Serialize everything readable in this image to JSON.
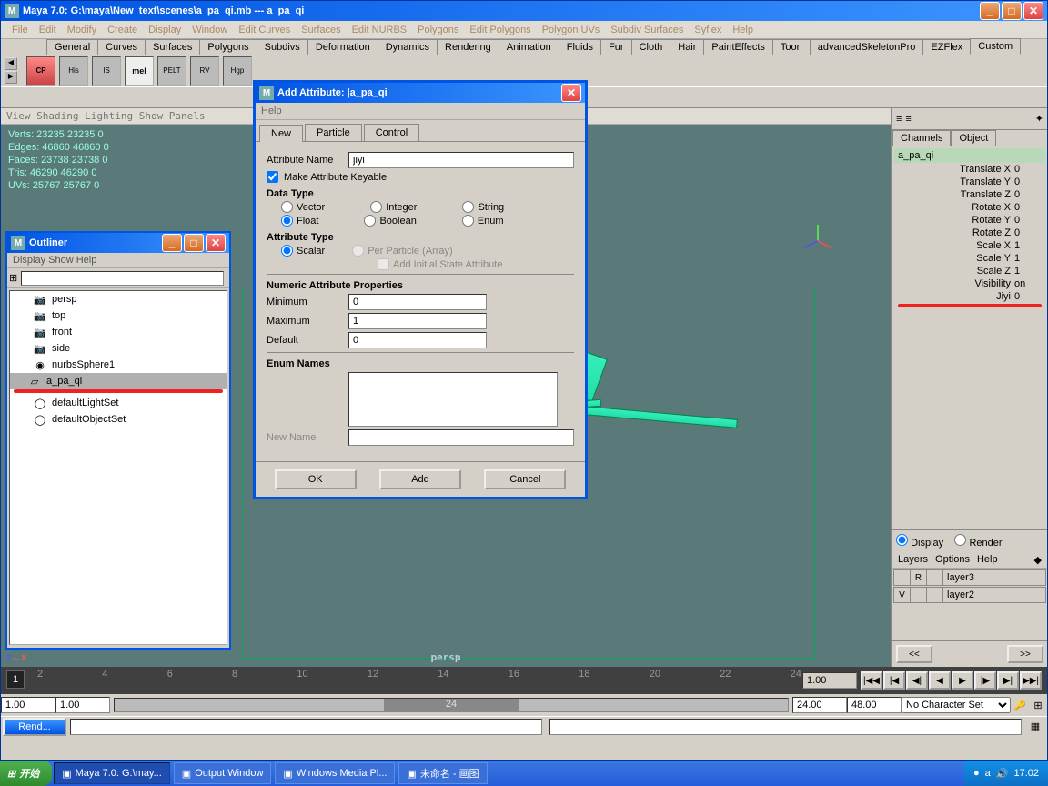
{
  "main": {
    "title": "Maya 7.0: G:\\maya\\New_text\\scenes\\a_pa_qi.mb  ---  a_pa_qi",
    "menus": [
      "File",
      "Edit",
      "Modify",
      "Create",
      "Display",
      "Window",
      "Edit Curves",
      "Surfaces",
      "Edit NURBS",
      "Polygons",
      "Edit Polygons",
      "Polygon UVs",
      "Subdiv Surfaces",
      "Syflex",
      "Help"
    ],
    "shelf_tabs": [
      "General",
      "Curves",
      "Surfaces",
      "Polygons",
      "Subdivs",
      "Deformation",
      "Dynamics",
      "Rendering",
      "Animation",
      "Fluids",
      "Fur",
      "Cloth",
      "Hair",
      "PaintEffects",
      "Toon",
      "advancedSkeletonPro",
      "EZFlex",
      "Custom"
    ],
    "shelf_icons": [
      "CP",
      "His",
      "IS",
      "mel",
      "PELT",
      "RV",
      "Hgp"
    ]
  },
  "viewport": {
    "menu": "View Shading Lighting Show Panels",
    "stats": {
      "verts": "Verts:  23235  23235  0",
      "edges": "Edges:  46860  46860  0",
      "faces": "Faces:  23738  23738  0",
      "tris": "Tris:   46290  46290  0",
      "uvs": "UVs:    25767  25767  0"
    },
    "label": "persp",
    "axis": "z←x"
  },
  "outliner": {
    "title": "Outliner",
    "menus": [
      "Display",
      "Show",
      "Help"
    ],
    "items": [
      {
        "icon": "cam",
        "name": "persp"
      },
      {
        "icon": "cam",
        "name": "top"
      },
      {
        "icon": "cam",
        "name": "front"
      },
      {
        "icon": "cam",
        "name": "side"
      },
      {
        "icon": "nurbs",
        "name": "nurbsSphere1"
      },
      {
        "icon": "mesh",
        "name": "a_pa_qi",
        "selected": true,
        "expand": true
      },
      {
        "icon": "set",
        "name": "defaultLightSet"
      },
      {
        "icon": "set",
        "name": "defaultObjectSet"
      }
    ]
  },
  "dialog": {
    "title": "Add Attribute: |a_pa_qi",
    "help": "Help",
    "tabs": [
      "New",
      "Particle",
      "Control"
    ],
    "attr_name_label": "Attribute Name",
    "attr_name": "jiyi",
    "keyable_label": "Make Attribute Keyable",
    "datatype_label": "Data Type",
    "datatypes": {
      "vector": "Vector",
      "integer": "Integer",
      "string": "String",
      "float": "Float",
      "boolean": "Boolean",
      "enum": "Enum"
    },
    "attrtype_label": "Attribute Type",
    "attrtypes": {
      "scalar": "Scalar",
      "perparticle": "Per Particle (Array)",
      "addinitial": "Add Initial State Attribute"
    },
    "numprops_label": "Numeric Attribute Properties",
    "min_label": "Minimum",
    "min": "0",
    "max_label": "Maximum",
    "max": "1",
    "def_label": "Default",
    "def": "0",
    "enum_label": "Enum Names",
    "newname_label": "New Name",
    "ok": "OK",
    "add": "Add",
    "cancel": "Cancel"
  },
  "channels": {
    "tabs": [
      "Channels",
      "Object"
    ],
    "object": "a_pa_qi",
    "rows": [
      {
        "label": "Translate X",
        "val": "0"
      },
      {
        "label": "Translate Y",
        "val": "0"
      },
      {
        "label": "Translate Z",
        "val": "0"
      },
      {
        "label": "Rotate X",
        "val": "0"
      },
      {
        "label": "Rotate Y",
        "val": "0"
      },
      {
        "label": "Rotate Z",
        "val": "0"
      },
      {
        "label": "Scale X",
        "val": "1"
      },
      {
        "label": "Scale Y",
        "val": "1"
      },
      {
        "label": "Scale Z",
        "val": "1"
      },
      {
        "label": "Visibility",
        "val": "on"
      },
      {
        "label": "Jiyi",
        "val": "0"
      }
    ]
  },
  "layers": {
    "display": "Display",
    "render": "Render",
    "menus": [
      "Layers",
      "Options",
      "Help"
    ],
    "rows": [
      {
        "vis": "",
        "ref": "R",
        "name": "layer3"
      },
      {
        "vis": "V",
        "ref": "",
        "name": "layer2"
      }
    ]
  },
  "time": {
    "ticks": [
      "2",
      "4",
      "6",
      "8",
      "10",
      "12",
      "14",
      "16",
      "18",
      "20",
      "22",
      "24"
    ],
    "current": "1",
    "range_start": "1.00",
    "range_startpad": "1.00",
    "range_end": "24.00",
    "range_endpad": "48.00",
    "charset": "No Character Set",
    "transport": [
      "|◀◀",
      "|◀",
      "◀|",
      "◀",
      "▶",
      "|▶",
      "▶|",
      "▶▶|"
    ],
    "scroll": {
      "left": "<<",
      "right": ">>"
    },
    "cur_field": "1.00",
    "rend": "Rend..."
  },
  "taskbar": {
    "start": "开始",
    "items": [
      {
        "label": "Maya 7.0: G:\\may...",
        "active": true
      },
      {
        "label": "Output Window"
      },
      {
        "label": "Windows Media Pl..."
      },
      {
        "label": "未命名 - 画图"
      }
    ],
    "clock": "17:02"
  }
}
